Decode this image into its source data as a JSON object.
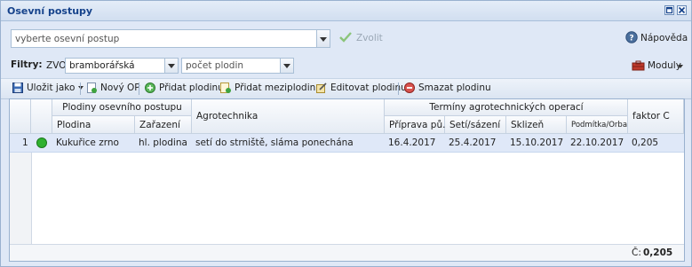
{
  "window": {
    "title": "Osevní postupy"
  },
  "select": {
    "placeholder": "vyberte osevní postup",
    "choose_label": "Zvolit",
    "help_label": "Nápověda"
  },
  "filters": {
    "label": "Filtry:",
    "zvo_label": "ZVO:",
    "zvo_value": "bramborářská",
    "count_placeholder": "počet plodin",
    "modules_label": "Moduly"
  },
  "toolbar": {
    "save_as": "Uložit jako",
    "new_op": "Nový OP",
    "add_crop": "Přidat plodinu",
    "add_intercrop": "Přidat meziplodinu",
    "edit_crop": "Editovat plodinu",
    "delete_crop": "Smazat plodinu"
  },
  "grid": {
    "group_crops": "Plodiny osevního postupu",
    "group_terms": "Termíny agrotechnických operací",
    "col_crop": "Plodina",
    "col_class": "Zařazení",
    "col_agro": "Agrotechnika",
    "col_prep": "Příprava pů...",
    "col_sow": "Setí/sázení",
    "col_harvest": "Sklizeň",
    "col_plow": "Podmítka/Orba",
    "col_factor": "faktor C",
    "rows": [
      {
        "num": "1",
        "status_color": "#2fb12f",
        "crop": "Kukuřice zrno",
        "class": "hl. plodina",
        "agro": "setí do strniště, sláma ponechána",
        "prep": "16.4.2017",
        "sow": "25.4.2017",
        "harvest": "15.10.2017",
        "plow": "22.10.2017",
        "factor": "0,205"
      }
    ],
    "footer_label": "Č:",
    "footer_value": "0,205"
  }
}
